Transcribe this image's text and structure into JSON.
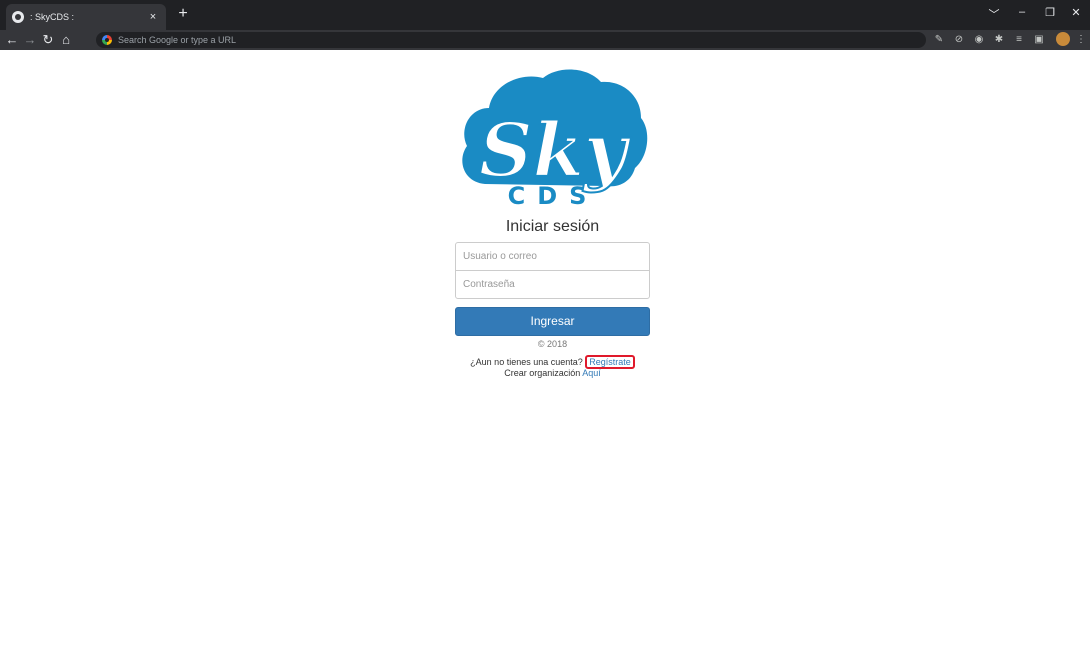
{
  "browser": {
    "tab_title": ": SkyCDS :",
    "tab_close": "×",
    "new_tab": "+",
    "omnibox_placeholder": "Search Google or type a URL",
    "window_controls": [
      "﹀",
      "–",
      "❐",
      "✕"
    ]
  },
  "logo": {
    "brand_word": "Sky",
    "brand_sub": "CDS",
    "color": "#1a8bc4"
  },
  "login": {
    "heading": "Iniciar sesión",
    "username_placeholder": "Usuario o correo",
    "password_placeholder": "Contraseña",
    "submit_label": "Ingresar",
    "copyright": "© 2018",
    "register_prompt": "¿Aun no tienes una cuenta?",
    "register_link": "Regístrate",
    "org_prompt": "Crear organización",
    "org_link": "Aquí"
  },
  "colors": {
    "accent": "#337ab7",
    "highlight": "#e0192b"
  }
}
